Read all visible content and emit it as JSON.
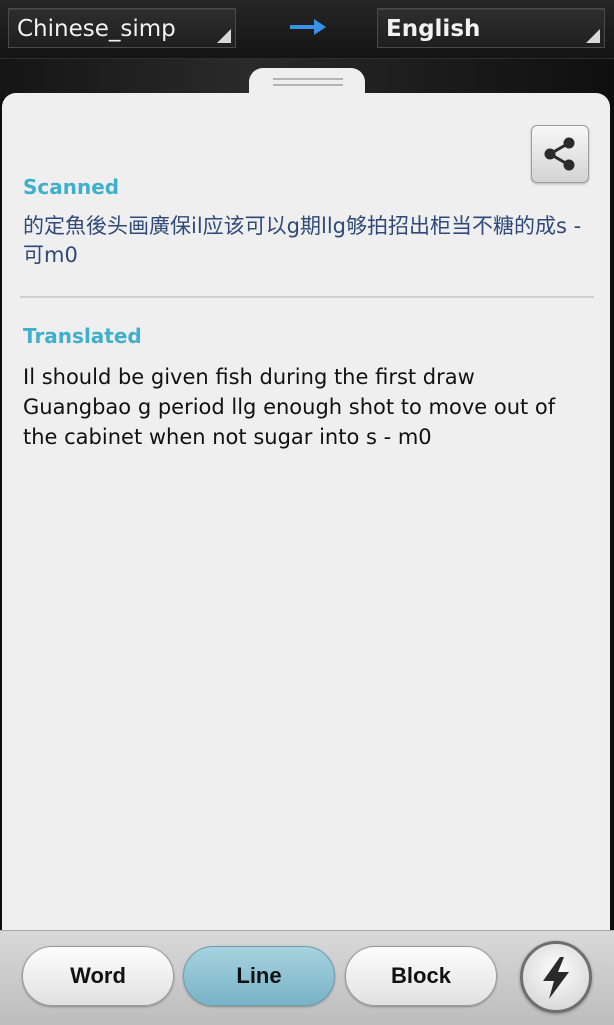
{
  "languages": {
    "source": "Chinese_simp",
    "target": "English",
    "arrow_icon": "arrow-right-icon",
    "arrow_color": "#3b8fe8"
  },
  "card": {
    "share_icon": "share-icon",
    "scanned": {
      "label": "Scanned",
      "text": "的定魚後头画廣保il应该可以g期llg够拍招出柜当不糖的成s -可m0"
    },
    "translated": {
      "label": "Translated",
      "text": "Il should be given fish during the first draw Guangbao g period llg enough shot to move out of the cabinet when not sugar into s - m0"
    },
    "label_color": "#3fb0cc"
  },
  "modes": {
    "word": "Word",
    "line": "Line",
    "block": "Block",
    "selected": "Line",
    "selected_color": "#8fc3d3"
  },
  "flash_icon": "flash-icon"
}
